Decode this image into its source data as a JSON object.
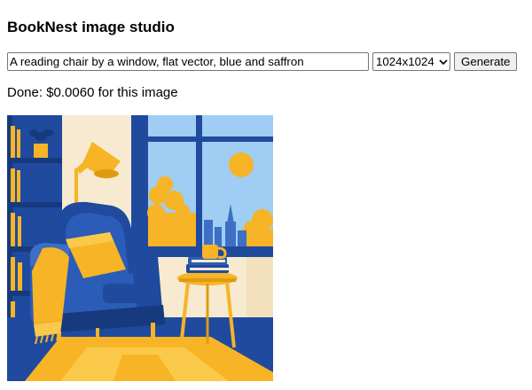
{
  "app": {
    "title": "BookNest image studio"
  },
  "form": {
    "prompt_value": "A reading chair by a window, flat vector, blue and saffron",
    "size_selected": "1024x1024",
    "generate_label": "Generate"
  },
  "status": {
    "text": "Done: $0.0060 for this image"
  },
  "image": {
    "description_icon": "generated-illustration",
    "colors": {
      "navy": "#1f4a9e",
      "saffron": "#f6b426",
      "cream": "#f7ead0",
      "sky": "#9fcdf3"
    }
  }
}
